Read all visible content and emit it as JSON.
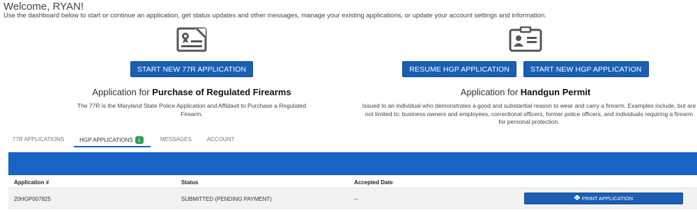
{
  "header": {
    "welcome": "Welcome, RYAN!",
    "intro": "Use the dashboard below to start or continue an application, get status updates and other messages, manage your existing applications, or update your account settings and information."
  },
  "panel_77r": {
    "icon": "certificate-document-icon",
    "start_button": "START NEW 77R APPLICATION",
    "title_prefix": "Application for",
    "title_bold": "Purchase of Regulated Firearms",
    "description": "The 77R is the Maryland State Police Application and Affidavit to Purchase a Regulated Firearm."
  },
  "panel_hgp": {
    "icon": "id-card-icon",
    "resume_button": "RESUME HGP APPLICATION",
    "start_button": "START NEW HGP APPLICATION",
    "title_prefix": "Application for",
    "title_bold": "Handgun Permit",
    "description": "Issued to an individual who demonstrates a good and substantial reason to wear and carry a firearm. Examples include, but are not limited to: business owners and employees, correctional officers, former police officers, and individuals requiring a firearm for personal protection."
  },
  "tabs": [
    {
      "label": "77R APPLICATIONS"
    },
    {
      "label": "HGP APPLICATIONS",
      "badge": "1"
    },
    {
      "label": "MESSAGES"
    },
    {
      "label": "ACCOUNT"
    }
  ],
  "table": {
    "columns": [
      "Application #",
      "Status",
      "Accepted Date"
    ],
    "rows": [
      {
        "application": "20HGP007825",
        "status": "SUBMITTED (PENDING PAYMENT)",
        "accepted_date": "--",
        "action": "PRINT APPLICATION"
      }
    ]
  },
  "colors": {
    "primary": "#1a5fb4",
    "banner": "#1a63c6",
    "badge": "#2e9e4f"
  }
}
